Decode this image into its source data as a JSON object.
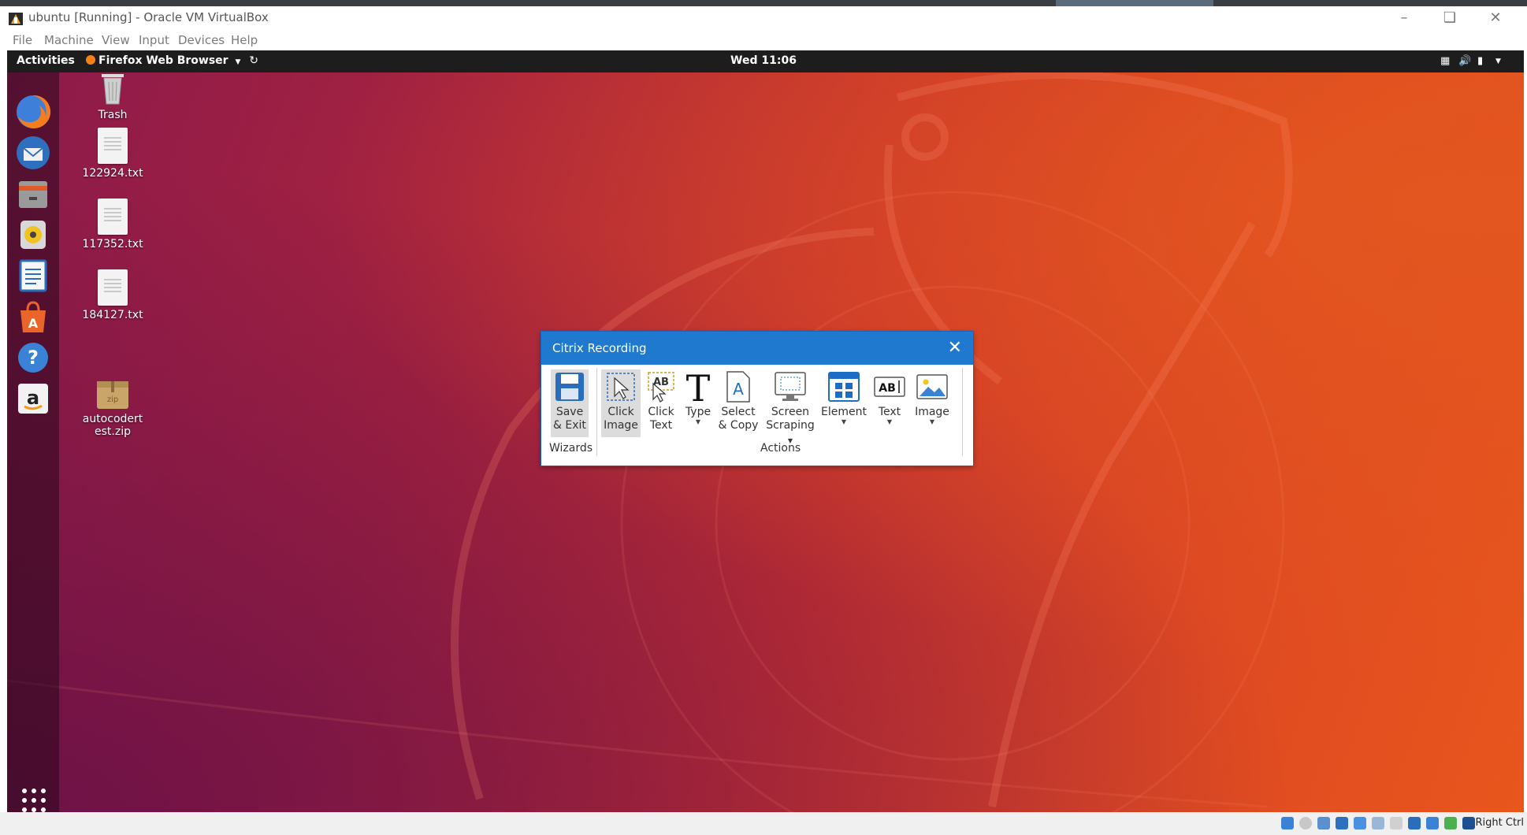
{
  "vbox": {
    "title": "ubuntu [Running] - Oracle VM VirtualBox",
    "menu": [
      "File",
      "Machine",
      "View",
      "Input",
      "Devices",
      "Help"
    ],
    "host_key": "Right Ctrl"
  },
  "topbar": {
    "activities": "Activities",
    "app_menu": "Firefox Web Browser",
    "clock": "Wed 11:06"
  },
  "dock": {
    "items": [
      "firefox",
      "thunderbird",
      "files",
      "rhythmbox",
      "libreoffice-writer",
      "ubuntu-software",
      "help",
      "amazon"
    ]
  },
  "desktop": {
    "icons": [
      {
        "label": "Trash"
      },
      {
        "label": "122924.txt"
      },
      {
        "label": "117352.txt"
      },
      {
        "label": "184127.txt"
      },
      {
        "label_line1": "autocodert",
        "label_line2": "est.zip",
        "badge": "zip"
      }
    ]
  },
  "dialog": {
    "title": "Citrix Recording",
    "wizards": {
      "label": "Wizards",
      "save": {
        "line1": "Save",
        "line2": "& Exit"
      }
    },
    "actions": {
      "label": "Actions",
      "click_image": {
        "line1": "Click",
        "line2": "Image"
      },
      "click_text": {
        "line1": "Click",
        "line2": "Text"
      },
      "type": {
        "line1": "Type"
      },
      "select_copy": {
        "line1": "Select",
        "line2": "& Copy"
      },
      "screen_scraping": {
        "line1": "Screen",
        "line2": "Scraping"
      },
      "element": {
        "line1": "Element"
      },
      "text": {
        "line1": "Text",
        "icon_text": "AB"
      },
      "image": {
        "line1": "Image"
      }
    }
  },
  "colors": {
    "dialog_title_bar": "#1e79cf",
    "topbar": "#1d1d1d"
  }
}
